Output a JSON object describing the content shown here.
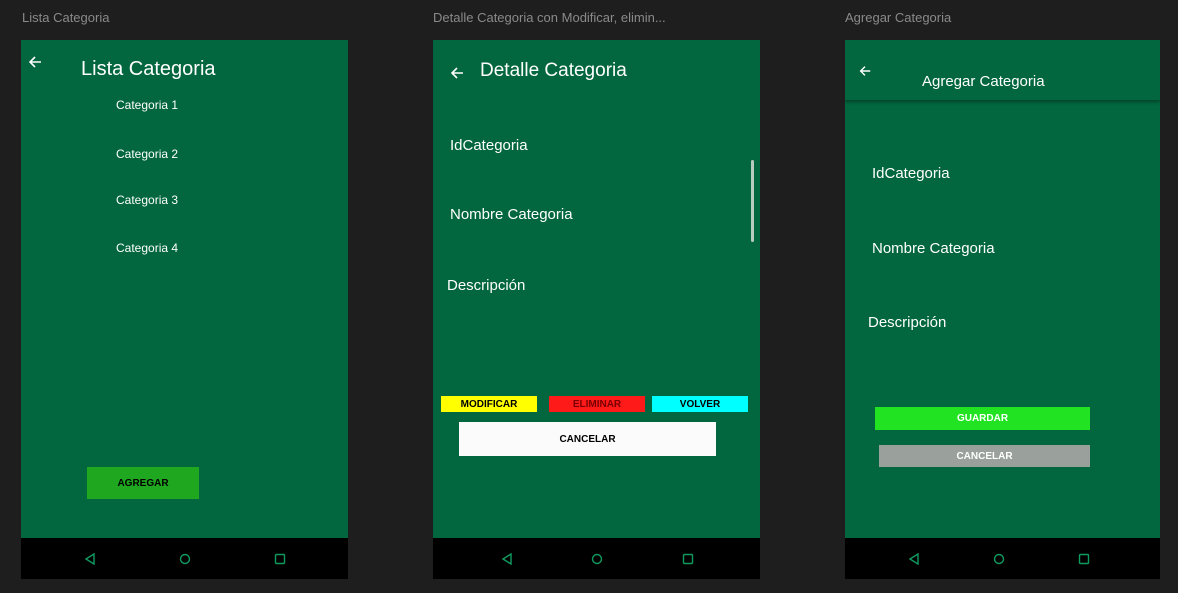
{
  "frames": {
    "lista": {
      "label": "Lista Categoria",
      "title": "Lista Categoria",
      "items": [
        "Categoria 1",
        "Categoria 2",
        "Categoria 3",
        "Categoria 4"
      ],
      "agregar_label": "AGREGAR"
    },
    "detalle": {
      "label": "Detalle Categoria con Modificar, elimin...",
      "title": "Detalle Categoria",
      "fields": [
        "IdCategoria",
        "Nombre Categoria",
        "Descripción"
      ],
      "modificar_label": "MODIFICAR",
      "eliminar_label": "ELIMINAR",
      "volver_label": "VOLVER",
      "cancelar_label": "CANCELAR"
    },
    "agregar": {
      "label": "Agregar Categoria",
      "title": "Agregar Categoria",
      "fields": [
        "IdCategoria",
        "Nombre Categoria",
        "Descripción"
      ],
      "guardar_label": "GUARDAR",
      "cancelar_label": "CANCELAR"
    }
  },
  "icons": {
    "back": "arrow-left-icon",
    "nav_back": "triangle-back-icon",
    "nav_home": "circle-home-icon",
    "nav_recents": "square-recents-icon"
  },
  "colors": {
    "background": "#1e1e1e",
    "screen": "#02663e",
    "navbar": "#000000",
    "nav_icon": "#0f9b60",
    "agregar": "#1fa81f",
    "modificar": "#ffff00",
    "eliminar": "#ff1a1a",
    "volver": "#00ffff",
    "cancelar_detalle": "#ffffff",
    "guardar": "#22e322",
    "cancelar_agregar": "#9aa09c"
  }
}
